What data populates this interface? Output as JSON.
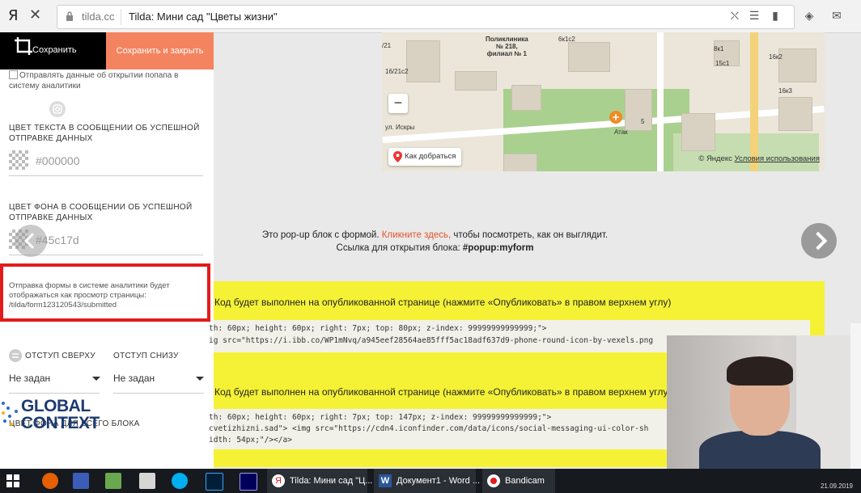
{
  "browser": {
    "logo": "Я",
    "close": "✕",
    "domain": "tilda.cc",
    "title": "Tilda: Мини сад \"Цветы жизни\""
  },
  "left_panel": {
    "save_label": "Сохранить",
    "save_close_label": "Сохранить и закрыть",
    "analytics_checkbox_label_1": "Отправлять данные об открытии попапа в",
    "analytics_checkbox_label_2": "систему аналитики",
    "success_text_color_header_1": "ЦВЕТ ТЕКСТА В СООБЩЕНИИ ОБ УСПЕШНОЙ",
    "success_text_color_header_2": "ОТПРАВКЕ ДАННЫХ",
    "success_text_color_value": "#000000",
    "success_bg_color_header_1": "ЦВЕТ ФОНА В СООБЩЕНИИ ОБ УСПЕШНОЙ",
    "success_bg_color_header_2": "ОТПРАВКЕ ДАННЫХ",
    "success_bg_color_value": "#45c17d",
    "analytics_note_1": "Отправка формы в системе аналитики будет",
    "analytics_note_2": "отображаться как просмотр страницы:",
    "analytics_note_3": "/tilda/form123120543/submitted",
    "padding_top_label": "ОТСТУП СВЕРХУ",
    "padding_bottom_label": "ОТСТУП СНИЗУ",
    "padding_top_value": "Не задан",
    "padding_bottom_value": "Не задан",
    "block_bg_header": "ЦВЕТ ФОНА ДЛЯ ВСЕГО БЛОКА",
    "watermark_line1": "GLOBAL",
    "watermark_line2": "CONTEXT"
  },
  "map": {
    "labels": {
      "clinic": "Поликлиника\n№ 218,\nфилиал № 1",
      "atak": "Атак",
      "street": "ул. Искры",
      "b1": "6к1с2",
      "b2": "8к1",
      "b3": "15с1",
      "b4": "16к2",
      "b5": "16/21с2",
      "b6": "/21",
      "b7": "16к3",
      "b8": "5"
    },
    "zoom_out": "−",
    "route_label": "Как добраться",
    "copyright_prefix": "© Яндекс",
    "terms_link": "Условия использования"
  },
  "popup_info": {
    "line1_a": "Это pop-up блок с формой.",
    "line1_link": "Кликните здесь,",
    "line1_b": "чтобы посмотреть, как он выглядит.",
    "line2_a": "Ссылка для открытия блока:",
    "line2_code": "#popup:myform"
  },
  "code_blocks": [
    {
      "notice": "Код будет выполнен на опубликованной странице (нажмите «Опубликовать» в правом верхнем углу)",
      "line1": "th: 60px; height: 60px; right: 7px; top: 80px; z-index: 99999999999999;\">",
      "line2": "ig src=\"https://i.ibb.co/WP1mNvq/a945eef28564ae85fff5ac18adf637d9-phone-round-icon-by-vexels.png"
    },
    {
      "notice": "Код будет выполнен на опубликованной странице (нажмите «Опубликовать» в правом верхнем углу)",
      "line1": "th: 60px; height: 60px; right: 7px; top: 147px; z-index: 99999999999999;\">",
      "line2": "cvetizhizni.sad\"> <img src=\"https://cdn4.iconfinder.com/data/icons/social-messaging-ui-color-sh",
      "line3": "idth: 54px;\"/></a>"
    }
  ],
  "taskbar": {
    "browser_item": "Tilda: Мини сад \"Ц...",
    "word_item": "Документ1 - Word ...",
    "bandicam_item": "Bandicam",
    "clock": "21.09.2019"
  },
  "colors": {
    "accent_orange": "#f4845f",
    "highlight_yellow": "#f5f236",
    "annotation_red": "#e21b1b",
    "link_red": "#e3542a"
  }
}
